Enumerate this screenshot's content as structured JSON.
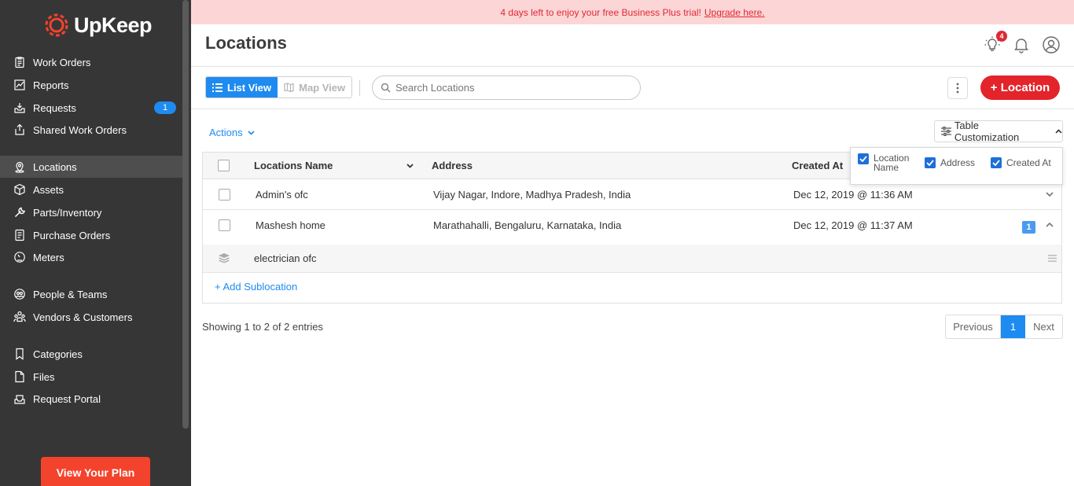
{
  "brand": {
    "name": "UpKeep",
    "accent": "#f4432c"
  },
  "sidebar": {
    "items": [
      {
        "label": "Work Orders",
        "icon": "clipboard-icon"
      },
      {
        "label": "Reports",
        "icon": "chart-icon"
      },
      {
        "label": "Requests",
        "icon": "inbox-icon",
        "badge": "1"
      },
      {
        "label": "Shared Work Orders",
        "icon": "share-icon"
      },
      {
        "label": "Locations",
        "icon": "location-pin-icon",
        "active": true
      },
      {
        "label": "Assets",
        "icon": "cube-icon"
      },
      {
        "label": "Parts/Inventory",
        "icon": "wrench-icon"
      },
      {
        "label": "Purchase Orders",
        "icon": "document-icon"
      },
      {
        "label": "Meters",
        "icon": "gauge-icon"
      },
      {
        "label": "People & Teams",
        "icon": "people-icon"
      },
      {
        "label": "Vendors & Customers",
        "icon": "vendors-icon"
      },
      {
        "label": "Categories",
        "icon": "bookmark-icon"
      },
      {
        "label": "Files",
        "icon": "file-icon"
      },
      {
        "label": "Request Portal",
        "icon": "portal-icon"
      }
    ],
    "plan_button": "View Your Plan"
  },
  "banner": {
    "text": "4 days left to enjoy your free Business Plus trial!",
    "link": "Upgrade here."
  },
  "header": {
    "title": "Locations",
    "notification_count": "4"
  },
  "toolbar": {
    "list_view": "List View",
    "map_view": "Map View",
    "search_placeholder": "Search Locations",
    "add_button": "+ Location"
  },
  "actions_label": "Actions",
  "table_customization": "Table Customization",
  "columns_popover": {
    "options": [
      "Location Name",
      "Address",
      "Created At"
    ]
  },
  "table": {
    "headers": {
      "name": "Locations Name",
      "address": "Address",
      "created": "Created At"
    },
    "rows": [
      {
        "name": "Admin's ofc",
        "address": "Vijay Nagar, Indore, Madhya Pradesh, India",
        "created": "Dec 12, 2019 @ 11:36 AM"
      },
      {
        "name": "Mashesh home",
        "address": "Marathahalli, Bengaluru, Karnataka, India",
        "created": "Dec 12, 2019 @ 11:37 AM",
        "sub_count": "1"
      }
    ],
    "sublocation": {
      "name": "electrician ofc"
    },
    "add_sublocation": "+ Add Sublocation"
  },
  "footer": {
    "showing": "Showing 1 to 2 of 2 entries",
    "prev": "Previous",
    "current_page": "1",
    "next": "Next"
  }
}
